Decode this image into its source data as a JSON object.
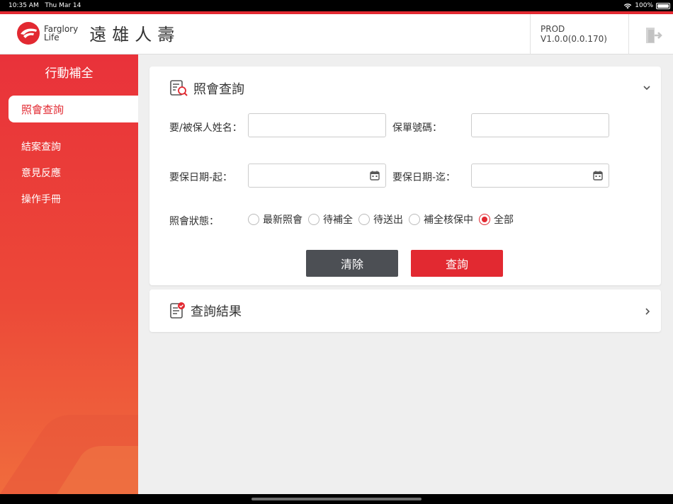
{
  "status_bar": {
    "time": "10:35 AM",
    "date": "Thu Mar 14",
    "battery": "100%"
  },
  "brand": {
    "name_en_line1": "Farglory",
    "name_en_line2": "Life",
    "name_zh": "遠雄人壽",
    "color": "#e22931"
  },
  "header": {
    "version": "PROD V1.0.0(0.0.170)"
  },
  "sidebar": {
    "title": "行動補全",
    "active_item": "照會查詢",
    "items": [
      "結案查詢",
      "意見反應",
      "操作手冊"
    ]
  },
  "search_card": {
    "title": "照會查詢",
    "fields": {
      "name_label": "要/被保人姓名：",
      "name_value": "",
      "policy_label": "保單號碼：",
      "policy_value": "",
      "date_from_label": "要保日期-起：",
      "date_from_value": "",
      "date_to_label": "要保日期-迄：",
      "date_to_value": ""
    },
    "status_label": "照會狀態：",
    "status_options": [
      "最新照會",
      "待補全",
      "待送出",
      "補全核保中",
      "全部"
    ],
    "status_selected": "全部",
    "clear_button": "清除",
    "query_button": "查詢"
  },
  "results_card": {
    "title": "查詢結果"
  }
}
